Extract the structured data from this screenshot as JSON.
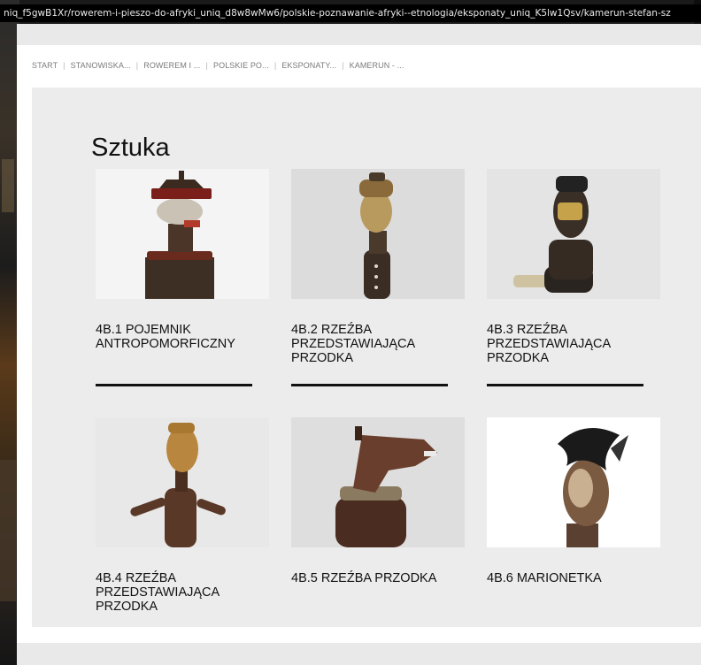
{
  "url": "niq_f5gwB1Xr/rowerem-i-pieszo-do-afryki_uniq_d8w8wMw6/polskie-poznawanie-afryki--etnologia/eksponaty_uniq_K5lw1Qsv/kamerun-stefan-sz",
  "breadcrumb": [
    "START",
    "STANOWISKA...",
    "ROWEREM I ...",
    "POLSKIE PO...",
    "EKSPONATY...",
    "KAMERUN - ..."
  ],
  "section_title": "Sztuka",
  "items": [
    {
      "title": "4B.1 POJEMNIK ANTROPOMORFICZNY"
    },
    {
      "title": "4B.2 RZEŹBA PRZEDSTAWIAJĄCA PRZODKA"
    },
    {
      "title": "4B.3 RZEŹBA PRZEDSTAWIAJĄCA PRZODKA"
    },
    {
      "title": "4B.4 RZEŹBA PRZEDSTAWIAJĄCA PRZODKA"
    },
    {
      "title": "4B.5 RZEŹBA PRZODKA"
    },
    {
      "title": "4B.6 MARIONETKA"
    }
  ],
  "colors": {
    "panel": "#ececec",
    "text": "#111111",
    "underline": "#111111"
  }
}
